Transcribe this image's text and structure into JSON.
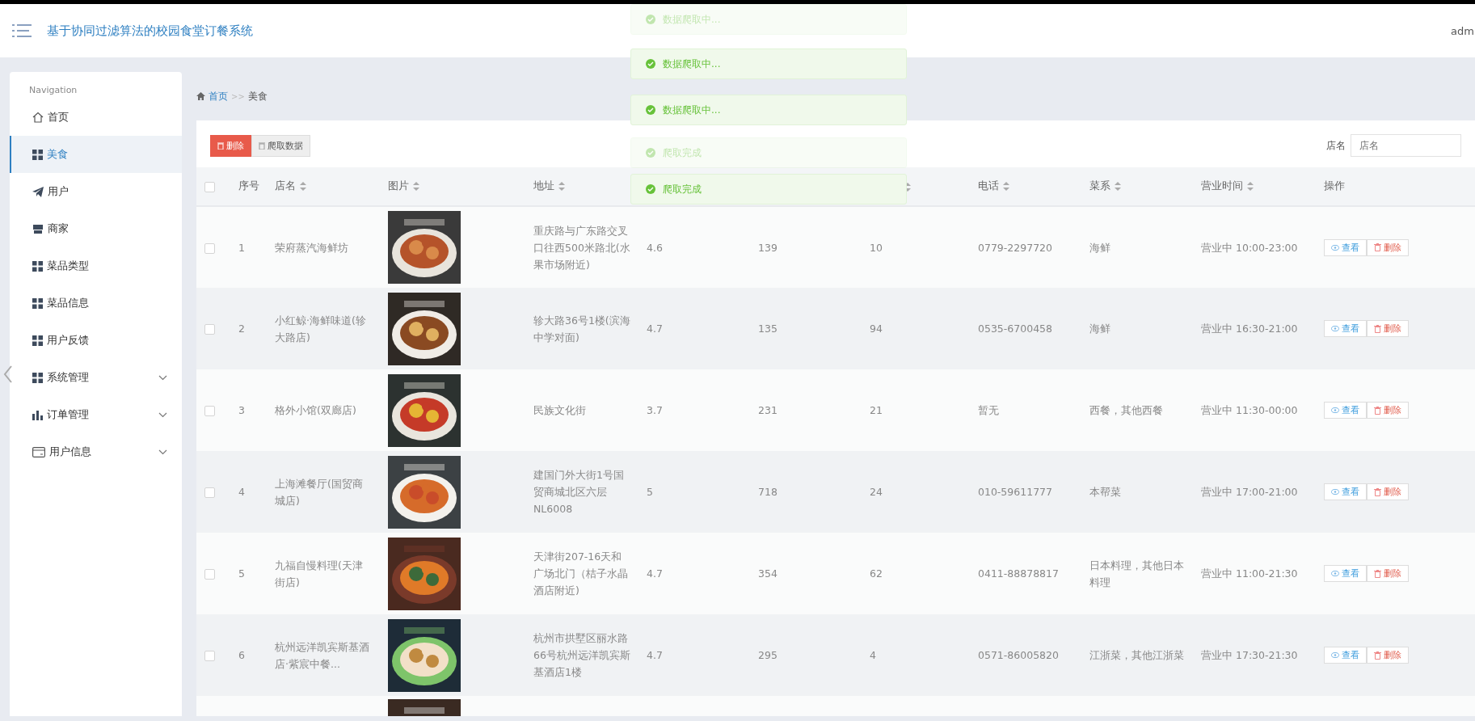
{
  "header": {
    "title": "基于协同过滤算法的校园食堂订餐系统",
    "user": "adm"
  },
  "sidebar": {
    "heading": "Navigation",
    "items": [
      {
        "label": "首页",
        "selected": false,
        "expandable": false
      },
      {
        "label": "美食",
        "selected": true,
        "expandable": false
      },
      {
        "label": "用户",
        "selected": false,
        "expandable": false
      },
      {
        "label": "商家",
        "selected": false,
        "expandable": false
      },
      {
        "label": "菜品类型",
        "selected": false,
        "expandable": false
      },
      {
        "label": "菜品信息",
        "selected": false,
        "expandable": false
      },
      {
        "label": "用户反馈",
        "selected": false,
        "expandable": false
      },
      {
        "label": "系统管理",
        "selected": false,
        "expandable": true
      },
      {
        "label": "订单管理",
        "selected": false,
        "expandable": true
      },
      {
        "label": "用户信息",
        "selected": false,
        "expandable": true
      }
    ]
  },
  "breadcrumb": {
    "home": "首页",
    "separator": ">>",
    "current": "美食"
  },
  "toolbar": {
    "buttons": [
      {
        "label": "删除",
        "kind": "danger"
      },
      {
        "label": "爬取数据",
        "kind": "plain"
      }
    ],
    "search": {
      "label": "店名",
      "placeholder": "店名"
    }
  },
  "table": {
    "select_all": {
      "checked": false
    },
    "columns": [
      {
        "label": "序号",
        "sortable": false
      },
      {
        "label": "店名",
        "sortable": true
      },
      {
        "label": "图片",
        "sortable": true
      },
      {
        "label": "地址",
        "sortable": true
      },
      {},
      {},
      {
        "sortable": true
      },
      {
        "label": "电话",
        "sortable": true
      },
      {
        "label": "菜系",
        "sortable": true
      },
      {
        "label": "营业时间",
        "sortable": true
      },
      {
        "label": "操作",
        "sortable": false
      }
    ],
    "rows": [
      {
        "checked": false,
        "actions": [
          {
            "label": "查看",
            "kind": "view"
          },
          {
            "label": "删除",
            "kind": "delete"
          }
        ],
        "cells": [
          "1",
          "荣府蒸汽海鲜坊",
          {
            "kind": "picture"
          },
          "重庆路与广东路交叉口往西500米路北(水果市场附近)",
          "4.6",
          "139",
          "10",
          "0779-2297720",
          "海鲜",
          "营业中 10:00-23:00"
        ]
      },
      {
        "checked": false,
        "actions": [
          {
            "label": "查看",
            "kind": "view"
          },
          {
            "label": "删除",
            "kind": "delete"
          }
        ],
        "cells": [
          "2",
          "小红鲸·海鲜味道(轸大路店)",
          {
            "kind": "picture"
          },
          "轸大路36号1楼(滨海中学对面)",
          "4.7",
          "135",
          "94",
          "0535-6700458",
          "海鲜",
          "营业中 16:30-21:00"
        ]
      },
      {
        "checked": false,
        "actions": [
          {
            "label": "查看",
            "kind": "view"
          },
          {
            "label": "删除",
            "kind": "delete"
          }
        ],
        "cells": [
          "3",
          "格外小馆(双廊店)",
          {
            "kind": "picture"
          },
          "民族文化街",
          "3.7",
          "231",
          "21",
          "暂无",
          "西餐，其他西餐",
          "营业中 11:30-00:00"
        ]
      },
      {
        "checked": false,
        "actions": [
          {
            "label": "查看",
            "kind": "view"
          },
          {
            "label": "删除",
            "kind": "delete"
          }
        ],
        "cells": [
          "4",
          "上海滩餐厅(国贸商城店)",
          {
            "kind": "picture"
          },
          "建国门外大街1号国贸商城北区六层NL6008",
          "5",
          "718",
          "24",
          "010-59611777",
          "本帮菜",
          "营业中 17:00-21:00"
        ]
      },
      {
        "checked": false,
        "actions": [
          {
            "label": "查看",
            "kind": "view"
          },
          {
            "label": "删除",
            "kind": "delete"
          }
        ],
        "cells": [
          "5",
          "九福自慢料理(天津街店)",
          {
            "kind": "picture"
          },
          "天津街207-16天和广场北门（桔子水晶酒店附近)",
          "4.7",
          "354",
          "62",
          "0411-88878817",
          "日本料理，其他日本料理",
          "营业中 11:00-21:30"
        ]
      },
      {
        "checked": false,
        "actions": [
          {
            "label": "查看",
            "kind": "view"
          },
          {
            "label": "删除",
            "kind": "delete"
          }
        ],
        "cells": [
          "6",
          "杭州远洋凯宾斯基酒店·紫宸中餐...",
          {
            "kind": "picture"
          },
          "杭州市拱墅区丽水路66号杭州远洋凯宾斯基酒店1楼",
          "4.7",
          "295",
          "4",
          "0571-86005820",
          "江浙菜，其他江浙菜",
          "营业中 17:30-21:30"
        ]
      }
    ],
    "partial_row": {
      "picture": {
        "kind": "picture"
      }
    }
  },
  "toasts": [
    {
      "text": "数据爬取中...",
      "faded": true
    },
    {
      "text": "数据爬取中...",
      "faded": false
    },
    {
      "text": "数据爬取中...",
      "faded": false
    },
    {
      "text": "爬取完成",
      "faded": true
    },
    {
      "text": "爬取完成",
      "faded": false
    }
  ]
}
